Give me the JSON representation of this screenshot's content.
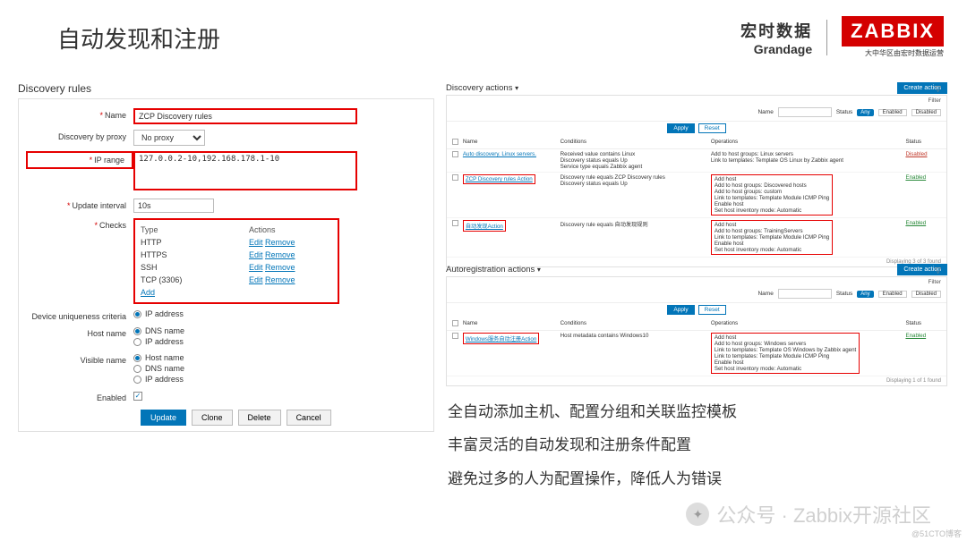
{
  "slide": {
    "title": "自动发现和注册"
  },
  "logo": {
    "cn": "宏时数据",
    "en": "Grandage",
    "zabbix": "ZABBIX",
    "sub": "大中华区由宏时数据运营"
  },
  "left": {
    "heading": "Discovery rules",
    "labels": {
      "name": "Name",
      "proxy": "Discovery by proxy",
      "iprange": "IP range",
      "interval": "Update interval",
      "checks": "Checks",
      "unique": "Device uniqueness criteria",
      "hostname": "Host name",
      "visiblename": "Visible name",
      "enabled": "Enabled"
    },
    "values": {
      "name": "ZCP Discovery rules",
      "proxy": "No proxy",
      "iprange": "127.0.0.2-10,192.168.178.1-10",
      "interval": "10s"
    },
    "checks": {
      "head_type": "Type",
      "head_actions": "Actions",
      "rows": [
        {
          "type": "HTTP",
          "edit": "Edit",
          "remove": "Remove"
        },
        {
          "type": "HTTPS",
          "edit": "Edit",
          "remove": "Remove"
        },
        {
          "type": "SSH",
          "edit": "Edit",
          "remove": "Remove"
        },
        {
          "type": "TCP (3306)",
          "edit": "Edit",
          "remove": "Remove"
        }
      ],
      "add": "Add"
    },
    "radios": {
      "ip": "IP address",
      "dns": "DNS name",
      "hostname": "Host name"
    },
    "buttons": {
      "update": "Update",
      "clone": "Clone",
      "delete": "Delete",
      "cancel": "Cancel"
    }
  },
  "right_disc": {
    "heading": "Discovery actions",
    "create": "Create action",
    "filter": {
      "name": "Name",
      "status": "Status",
      "any": "Any",
      "enabled": "Enabled",
      "disabled": "Disabled",
      "apply": "Apply",
      "reset": "Reset",
      "filter": "Filter"
    },
    "cols": {
      "name": "Name",
      "cond": "Conditions",
      "ops": "Operations",
      "status": "Status"
    },
    "rows": [
      {
        "name": "Auto discovery. Linux servers.",
        "cond": "Received value contains Linux\nDiscovery status equals Up\nService type equals Zabbix agent",
        "ops": "Add to host groups: Linux servers\nLink to templates: Template OS Linux by Zabbix agent",
        "status": "Disabled",
        "st_class": "st-disabled",
        "hl_name": false,
        "hl_ops": false
      },
      {
        "name": "ZCP Discovery rules Action",
        "cond": "Discovery rule equals ZCP Discovery rules\nDiscovery status equals Up",
        "ops": "Add host\nAdd to host groups: Discovered hosts\nAdd to host groups: custom\nLink to templates: Template Module ICMP Ping\nEnable host\nSet host inventory mode: Automatic",
        "status": "Enabled",
        "st_class": "st-enabled",
        "hl_name": true,
        "hl_ops": true
      },
      {
        "name": "自动发现Action",
        "cond": "Discovery rule equals 自动发现规则",
        "ops": "Add host\nAdd to host groups: TrainingServers\nLink to templates: Template Module ICMP Ping\nEnable host\nSet host inventory mode: Automatic",
        "status": "Enabled",
        "st_class": "st-enabled",
        "hl_name": true,
        "hl_ops": true
      }
    ],
    "foot": "Displaying 3 of 3 found"
  },
  "right_auto": {
    "heading": "Autoregistration actions",
    "create": "Create action",
    "rows": [
      {
        "name": "Windows服务自动注册Action",
        "cond": "Host metadata contains Windows10",
        "ops": "Add host\nAdd to host groups: Windows servers\nLink to templates: Template OS Windows by Zabbix agent\nLink to templates: Template Module ICMP Ping\nEnable host\nSet host inventory mode: Automatic",
        "status": "Enabled",
        "st_class": "st-enabled"
      }
    ],
    "foot": "Displaying 1 of 1 found"
  },
  "bullets": {
    "b1": "全自动添加主机、配置分组和关联监控模板",
    "b2": "丰富灵活的自动发现和注册条件配置",
    "b3": "避免过多的人为配置操作，降低人为错误"
  },
  "watermark": "公众号 · Zabbix开源社区",
  "attrib": "@51CTO博客"
}
